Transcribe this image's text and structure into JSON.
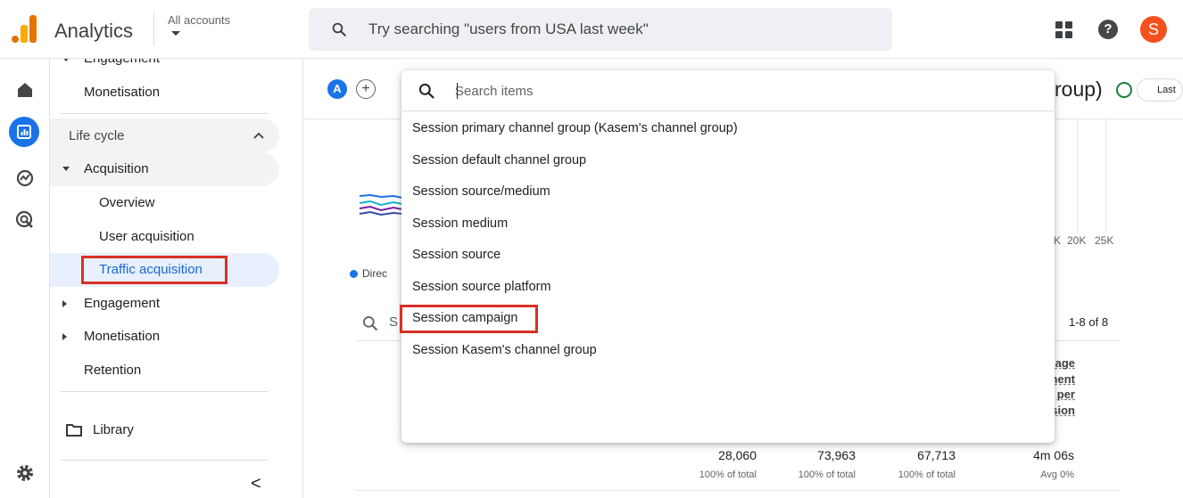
{
  "header": {
    "app_title": "Analytics",
    "account_label": "All accounts",
    "search_placeholder": "Try searching \"users from USA last week\"",
    "avatar_letter": "S",
    "help_glyph": "?"
  },
  "rail": {
    "icons": [
      "home-icon",
      "reports-icon",
      "explore-icon",
      "advertising-icon",
      "settings-icon"
    ]
  },
  "nav": {
    "top_partial": "Engagement",
    "monetisation_top": "Monetisation",
    "lifecycle": "Life cycle",
    "acquisition": "Acquisition",
    "overview": "Overview",
    "user_acquisition": "User acquisition",
    "traffic_acquisition": "Traffic acquisition",
    "engagement": "Engagement",
    "monetisation": "Monetisation",
    "retention": "Retention",
    "library": "Library",
    "collapse_glyph": "<"
  },
  "main": {
    "chip_a": "A",
    "chip_plus": "+",
    "title_fragment": "roup)",
    "last_chip": "Last",
    "legend_fragment": "Direc",
    "axis_ticks": [
      "K",
      "20K",
      "25K"
    ],
    "table_search_fragment": "S",
    "pager": "1-8 of 8",
    "metric_header_lines": [
      "age",
      "nent",
      "per",
      "sion"
    ],
    "totals": [
      {
        "value": "28,060",
        "sub": "100% of total"
      },
      {
        "value": "73,963",
        "sub": "100% of total"
      },
      {
        "value": "67,713",
        "sub": "100% of total"
      },
      {
        "value": "4m 06s",
        "sub": "Avg 0%"
      }
    ]
  },
  "dropdown": {
    "search_placeholder": "Search items",
    "items": [
      "Session primary channel group (Kasem's channel group)",
      "Session default channel group",
      "Session source/medium",
      "Session medium",
      "Session source",
      "Session source platform",
      "Session campaign",
      "Session Kasem's channel group"
    ]
  },
  "colors": {
    "accent": "#1a73e8",
    "highlight_box": "#d93025",
    "avatar": "#f4511e",
    "active_nav_bg": "#e8f0fe"
  }
}
